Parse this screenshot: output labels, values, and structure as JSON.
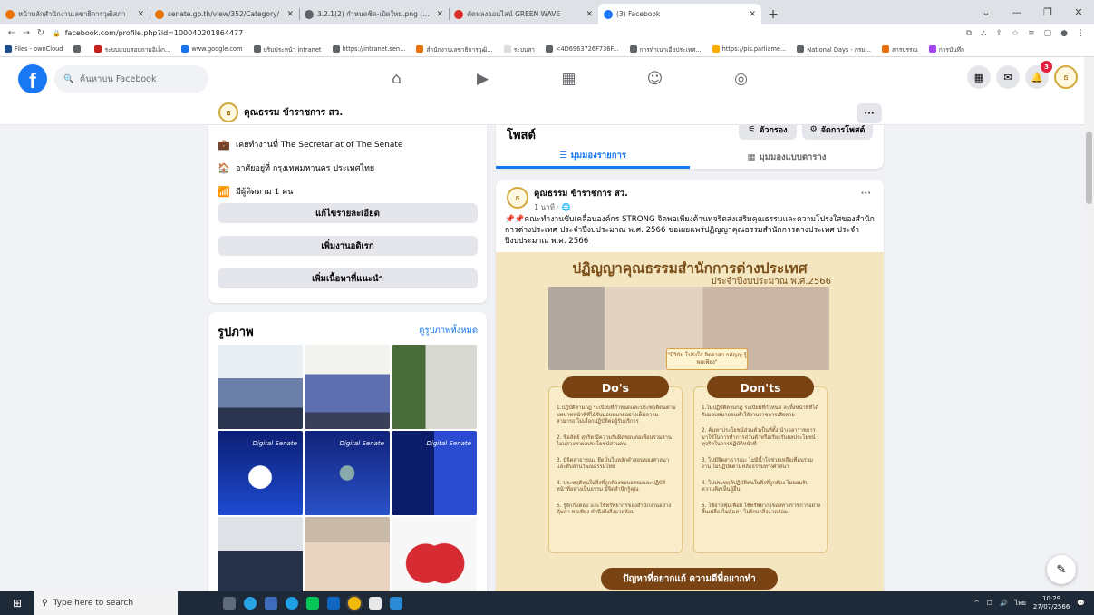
{
  "browser": {
    "tabs": [
      {
        "title": "หน้าหลักสำนักงานเลขาธิการวุฒิสภา",
        "color": "#e8710a"
      },
      {
        "title": "senate.go.th/view/352/Category/",
        "color": "#e8710a"
      },
      {
        "title": "3.2.1(2) กำหนดชิด-เปิดใหม่.png (84)",
        "color": "#5f6368"
      },
      {
        "title": "คัดหลงออนไลน์ GREEN WAVE",
        "color": "#d93025"
      },
      {
        "title": "(3) Facebook",
        "color": "#1877f2"
      }
    ],
    "active_tab": 4,
    "url": "facebook.com/profile.php?id=100040201864477",
    "bookmarks": [
      {
        "label": "Files - ownCloud",
        "color": "#1d4e89"
      },
      {
        "label": "",
        "color": "#5f6368"
      },
      {
        "label": "ระบบแบบสอบถามอิเล็ก...",
        "color": "#c5221f"
      },
      {
        "label": "www.google.com",
        "color": "#1a73e8"
      },
      {
        "label": "บริบประหน้า intranet",
        "color": "#5f6368"
      },
      {
        "label": "https://intranet.sen...",
        "color": "#5f6368"
      },
      {
        "label": "สำนักงานเลขาธิการวุฒิ...",
        "color": "#e8710a"
      },
      {
        "label": "ระบบสา",
        "color": "#dadce0"
      },
      {
        "label": "<4D6963726F736F...",
        "color": "#5f6368"
      },
      {
        "label": "การทำเนาเอียประเทศ...",
        "color": "#5f6368"
      },
      {
        "label": "https://pis.parliame...",
        "color": "#f9ab00"
      },
      {
        "label": "National Days - กรม...",
        "color": "#5f6368"
      },
      {
        "label": "สารบรรณ",
        "color": "#e8710a"
      },
      {
        "label": "การบันทึก",
        "color": "#a142f4"
      }
    ]
  },
  "facebook": {
    "search_placeholder": "ค้นหาบน Facebook",
    "notification_count": "3",
    "profile_name": "คุณธรรม ข้าราชการ สว.",
    "intro": [
      {
        "icon": "briefcase-icon",
        "glyph": "💼",
        "text": "เคยทำงานที่ The Secretariat of The Senate"
      },
      {
        "icon": "home-icon",
        "glyph": "🏠",
        "text": "อาศัยอยู่ที่ กรุงเทพมหานคร ประเทศไทย"
      },
      {
        "icon": "rss-icon",
        "glyph": "📶",
        "text": "มีผู้ติดตาม 1 คน"
      }
    ],
    "buttons": {
      "edit_details": "แก้ไขรายละเอียด",
      "add_hobbies": "เพิ่มงานอดิเรก",
      "add_featured": "เพิ่มเนื้อหาที่แนะนำ"
    },
    "photos": {
      "title": "รูปภาพ",
      "see_all": "ดูรูปภาพทั้งหมด",
      "digital_label": "Digital Senate"
    },
    "posts": {
      "title": "โพสต์",
      "filter": "ตัวกรอง",
      "manage": "จัดการโพสต์",
      "list_view": "มุมมองรายการ",
      "grid_view": "มุมมองแบบตาราง"
    },
    "post": {
      "author": "คุณธรรม ข้าราชการ สว.",
      "time": "1 นาที · 🌐",
      "text": "📌📌คณะทำงานขับเคลื่อนองค์กร STRONG จิตพอเพียงต้านทุจริตส่งเสริมคุณธรรมและความโปร่งใสของสำนักการต่างประเทศ ประจำปีงบประมาณ พ.ศ. 2566 ขอเผยแพร่ปฏิญญาคุณธรรมสำนักการต่างประเทศ ประจำปีงบประมาณ พ.ศ. 2566",
      "image": {
        "title": "ปฏิญญาคุณธรรมสำนักการต่างประเทศ",
        "subtitle": "ประจำปีงบประมาณ พ.ศ.2566",
        "caption": "\"มีวินัย โปร่งใส จิตอาสา กตัญญู รู้พอเพียง\"",
        "dos_title": "Do's",
        "donts_title": "Don'ts",
        "dos": [
          "1.ปฏิบัติตามกฎ ระเบียบที่กำหนดและประพฤติตนตามบทบาทหน้าที่ที่ได้รับมอบหมายอย่างเต็มความสามารถ ไม่เลือกปฏิบัติต่อผู้รับบริการ",
          "2. ซื่อสัตย์ สุจริต มีความรับผิดชอบต่อเพื่อนร่วมงานไม่แสวงหาผลประโยชน์ส่วนตน",
          "3. มีจิตสาธารณะ ยึดมั่นในหลักคำสอนของศาสนาและสืบสานวัฒนธรรมไทย",
          "4. ประพฤติตนในสิ่งที่ถูกต้องชอบธรรมและปฏิบัติหน้าที่อย่างเป็นธรรม มีจิตสำนึกรู้คุณ",
          "5. รู้จักกับตอบ และใช้ทรัพยากรของสำนักงานอย่างคุ้มค่า พอเพียง คำนึงถึงสิ่งแวดล้อม"
        ],
        "donts": [
          "1.ไม่ปฏิบัติตามกฎ ระเบียบที่กำหนด ละทิ้งหน้าที่ที่ได้รับมอบหมายจนทำให้งานราชการเสียหาย",
          "2. ค้นหาประโยชน์ส่วนตัวเป็นที่ตั้ง นำเวลาราชการมาใช้ในการทำการส่วนตัวหรือเรียกรับผลประโยชน์ ทุจริตในการปฏิบัติหน้าที่",
          "3. ไม่มีจิตสาธารณะ ไม่มีน้ำใจช่วยเหลือเพื่อนร่วมงาน ไม่ปฏิบัติตามหลักธรรมทางศาสนา",
          "4. ไม่ประพฤติปฏิบัติตนในสิ่งที่ถูกต้อง ไม่ยอมรับความคิดเห็นผู้อื่น",
          "5. ใช้จ่ายฟุ่มเฟือย ใช้ทรัพยากรของทางราชการอย่างสิ้นเปลืองไม่คุ้มค่า ไม่รักษาสิ่งแวดล้อม"
        ],
        "bottom": "ปัญหาที่อยากแก้ ความดีที่อยากทำ"
      }
    }
  },
  "taskbar": {
    "search_placeholder": "Type here to search",
    "time": "10:29",
    "date": "27/07/2566",
    "lang": "ไทย"
  }
}
